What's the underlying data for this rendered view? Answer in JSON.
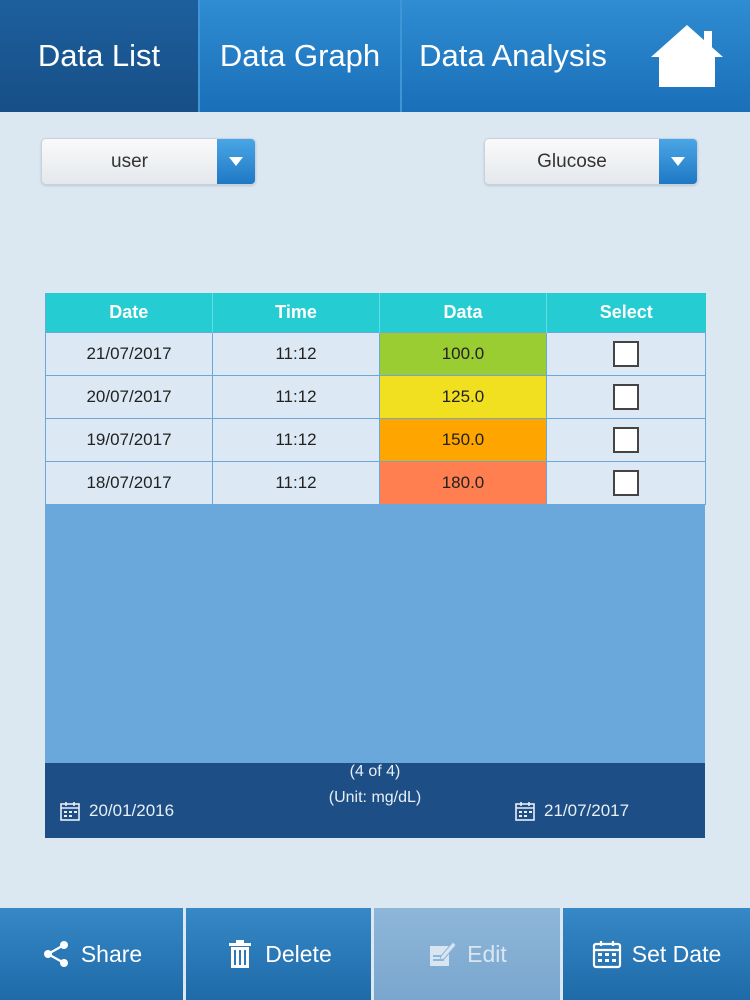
{
  "tabs": {
    "data_list": "Data List",
    "data_graph": "Data Graph",
    "data_analysis": "Data Analysis"
  },
  "home_icon": "home-icon",
  "dropdowns": {
    "user": "user",
    "measurement": "Glucose"
  },
  "table": {
    "headers": [
      "Date",
      "Time",
      "Data",
      "Select"
    ],
    "rows": [
      {
        "date": "21/07/2017",
        "time": "11:12",
        "data": "100.0",
        "color": "#9acd32"
      },
      {
        "date": "20/07/2017",
        "time": "11:12",
        "data": "125.0",
        "color": "#f0e020"
      },
      {
        "date": "19/07/2017",
        "time": "11:12",
        "data": "150.0",
        "color": "#ffa500"
      },
      {
        "date": "18/07/2017",
        "time": "11:12",
        "data": "180.0",
        "color": "#ff7f50"
      }
    ],
    "page_count": "(4 of 4)",
    "unit": "(Unit: mg/dL)",
    "date_from": "20/01/2016",
    "date_to": "21/07/2017"
  },
  "bottom": {
    "share": "Share",
    "delete": "Delete",
    "edit": "Edit",
    "set_date": "Set Date"
  },
  "colors": {
    "header_cyan": "#25ccd1",
    "footer_navy": "#1d4f86",
    "bar_blue": "#1f6aa9"
  }
}
